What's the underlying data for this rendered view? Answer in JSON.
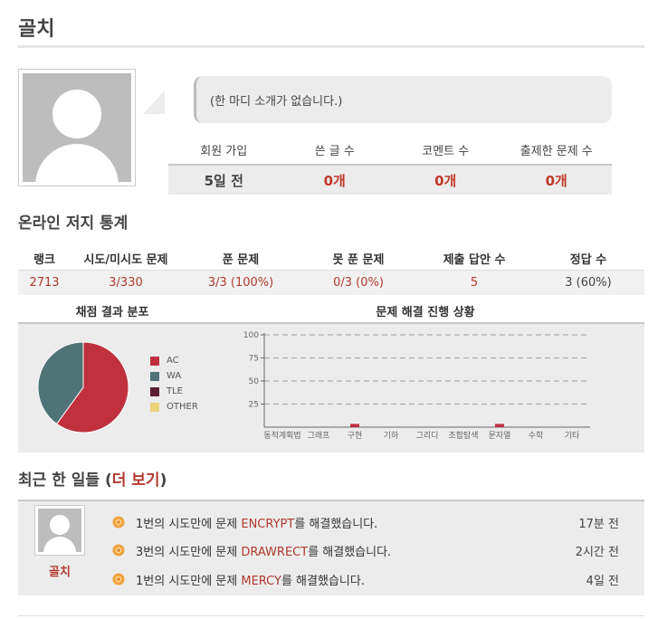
{
  "profile": {
    "name": "골치",
    "intro": "(한 마디 소개가 없습니다.)",
    "stats": [
      {
        "label": "회원 가입",
        "value": "5일 전"
      },
      {
        "label": "쓴 글 수",
        "value": "0개"
      },
      {
        "label": "코멘트 수",
        "value": "0개"
      },
      {
        "label": "출제한 문제 수",
        "value": "0개"
      }
    ]
  },
  "judge": {
    "heading": "온라인 저지 통계",
    "headers": [
      "랭크",
      "시도/미시도 문제",
      "푼 문제",
      "못 푼 문제",
      "제출 답안 수",
      "정답 수"
    ],
    "values": [
      "2713",
      "3/330",
      "3/3 (100%)",
      "0/3 (0%)",
      "5",
      "3 (60%)"
    ]
  },
  "pie_title": "채점 결과 분포",
  "bar_title": "문제 해결 진행 상황",
  "chart_data": [
    {
      "type": "pie",
      "title": "채점 결과 분포",
      "categories": [
        "AC",
        "WA",
        "TLE",
        "OTHER"
      ],
      "values": [
        3,
        2,
        0,
        0
      ],
      "colors": [
        "#c0303e",
        "#4f7377",
        "#5a1e35",
        "#ecd27a"
      ],
      "legend": "right"
    },
    {
      "type": "bar",
      "title": "문제 해결 진행 상황",
      "categories": [
        "동적계획법",
        "그래프",
        "구현",
        "기하",
        "그리디",
        "조합탐색",
        "문자열",
        "수학",
        "기타"
      ],
      "values": [
        0,
        0,
        3.5,
        0,
        0,
        0,
        3.5,
        0,
        0
      ],
      "yticks": [
        25,
        50,
        75,
        100
      ],
      "ylim": [
        0,
        100
      ],
      "grid": true,
      "color": "#c0303e"
    }
  ],
  "recent": {
    "heading_prefix": "최근 한 일들 (",
    "more_label": "더 보기",
    "heading_suffix": ")",
    "user": "골치",
    "activities": [
      {
        "pre": "1번의 시도만에 문제 ",
        "problem": "ENCRYPT",
        "post": "를 해결했습니다.",
        "time": "17분 전"
      },
      {
        "pre": "3번의 시도만에 문제 ",
        "problem": "DRAWRECT",
        "post": "를 해결했습니다.",
        "time": "2시간 전"
      },
      {
        "pre": "1번의 시도만에 문제 ",
        "problem": "MERCY",
        "post": "를 해결했습니다.",
        "time": "4일 전"
      }
    ]
  }
}
